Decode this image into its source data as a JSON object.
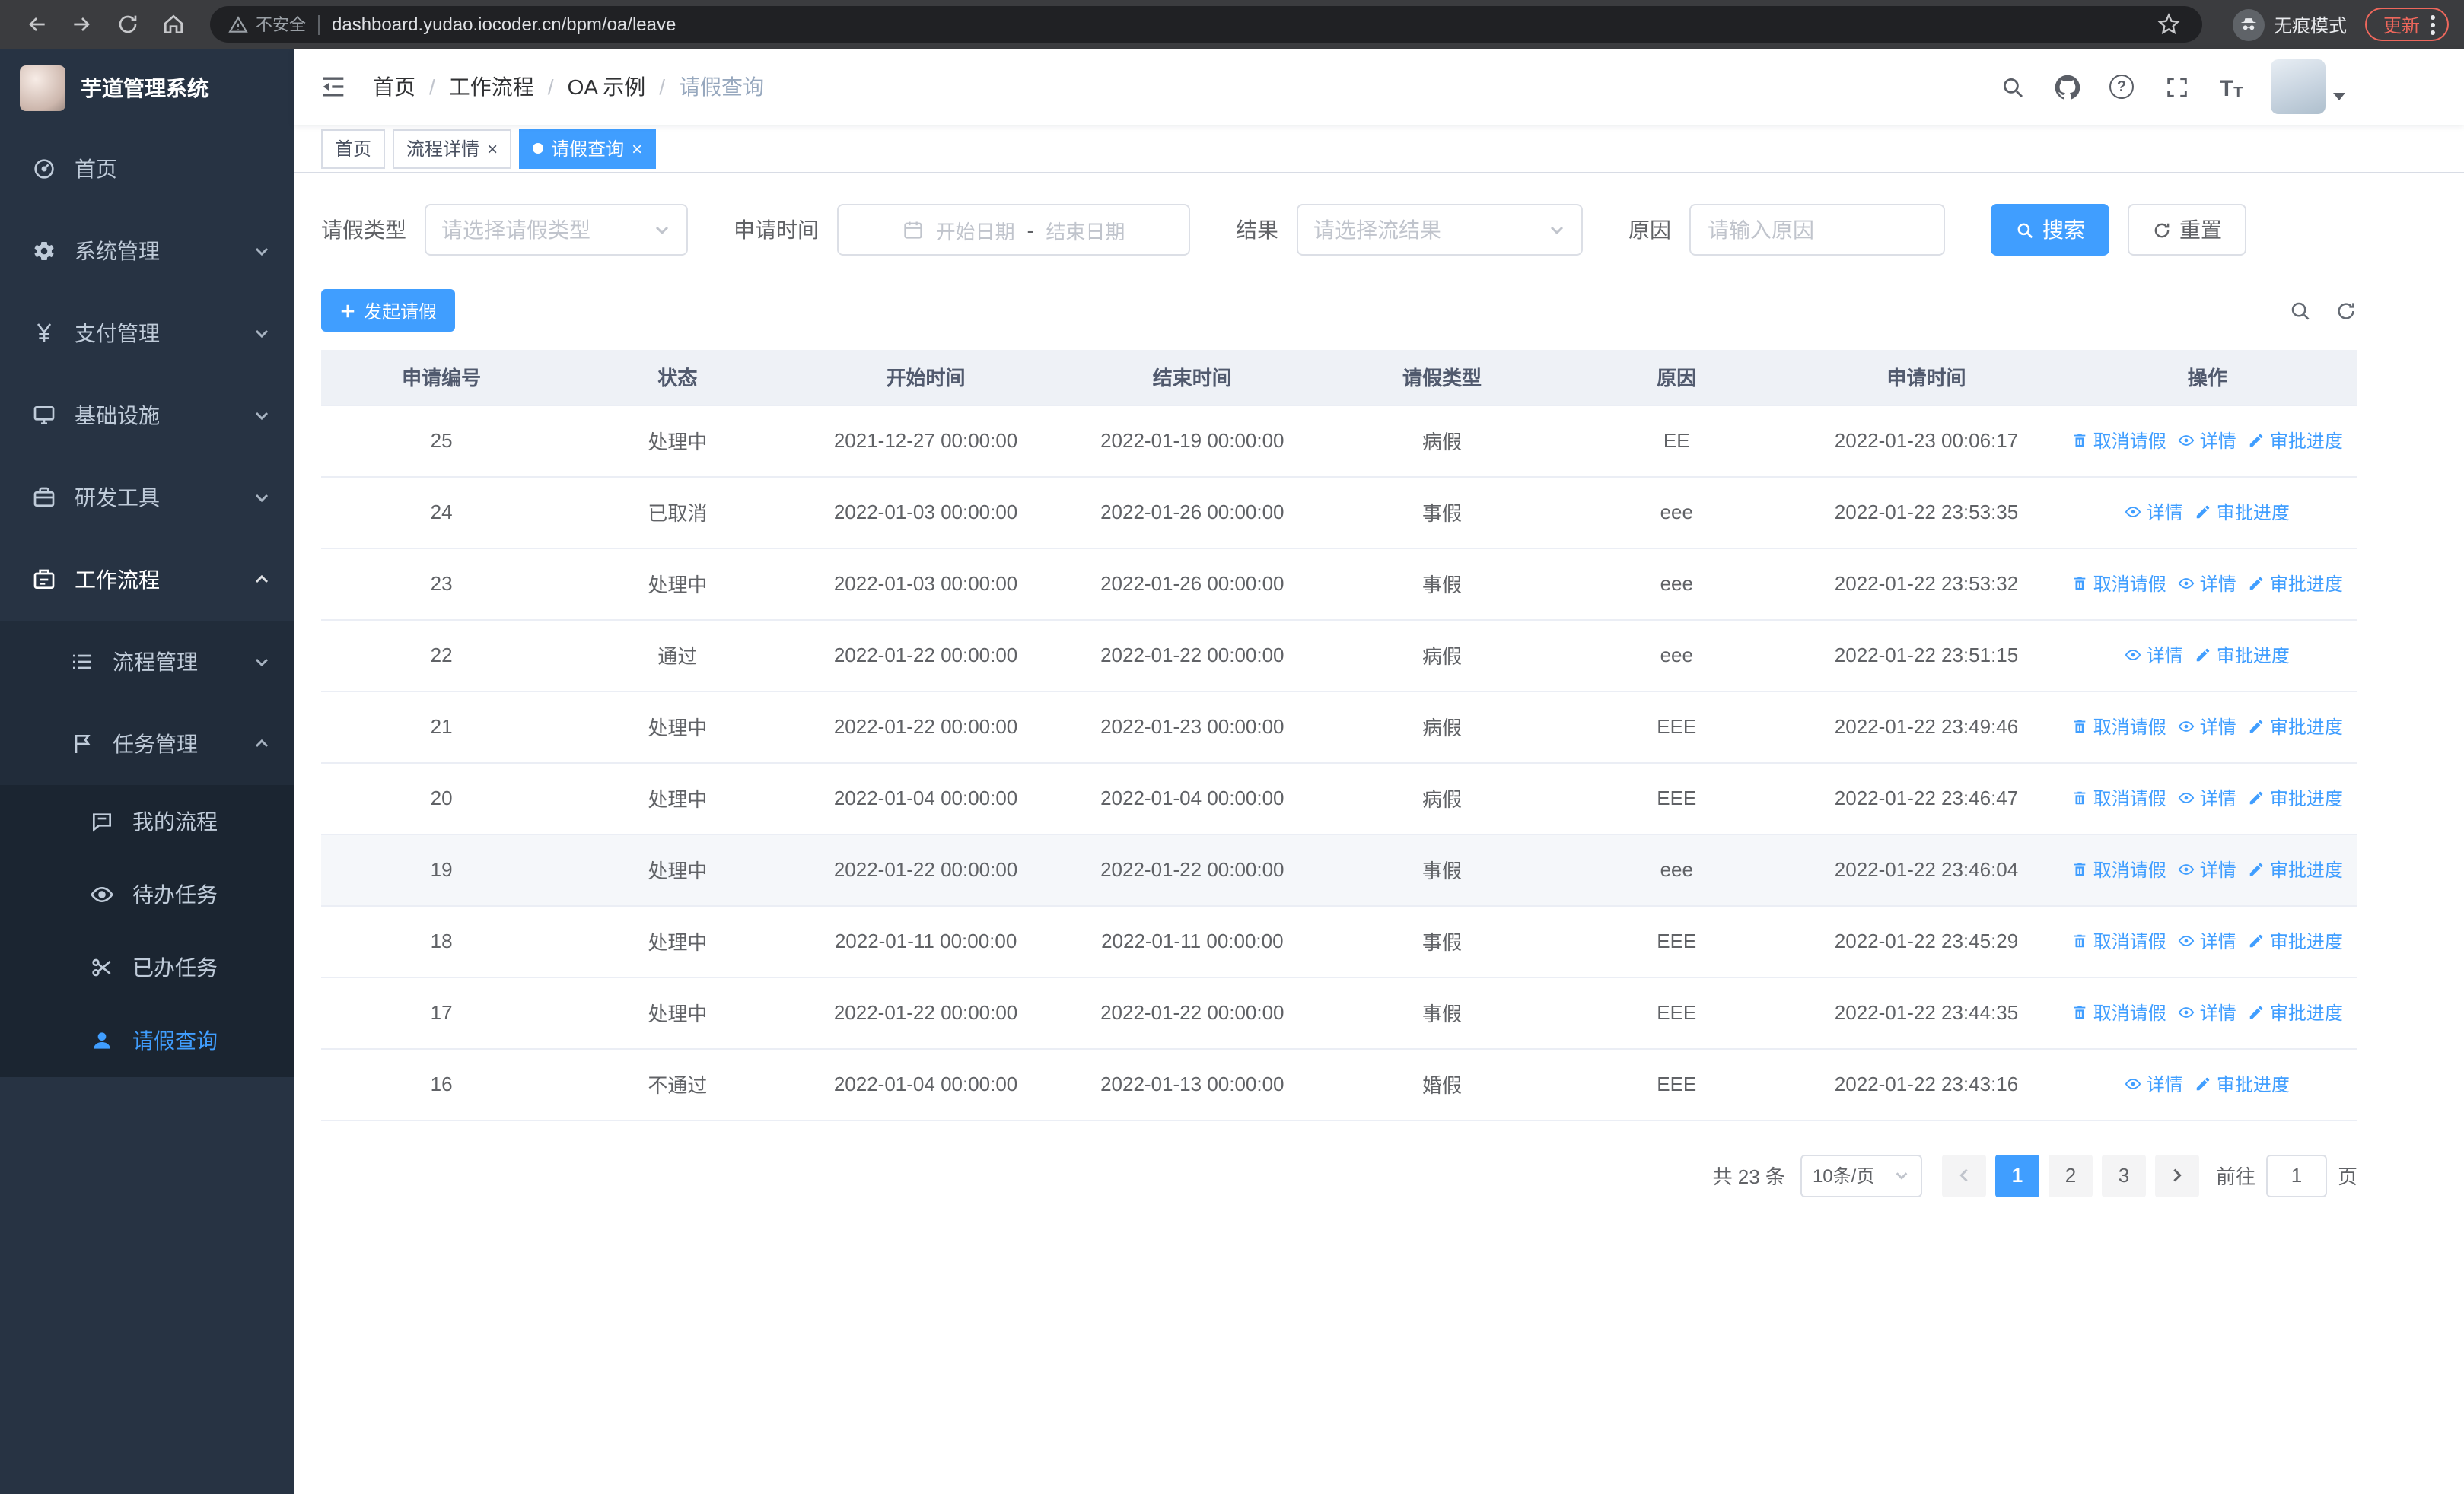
{
  "browser": {
    "security_label": "不安全",
    "url": "dashboard.yudao.iocoder.cn/bpm/oa/leave",
    "incognito_label": "无痕模式",
    "update_label": "更新"
  },
  "sidebar": {
    "logo_title": "芋道管理系统",
    "items": [
      {
        "label": "首页"
      },
      {
        "label": "系统管理"
      },
      {
        "label": "支付管理"
      },
      {
        "label": "基础设施"
      },
      {
        "label": "研发工具"
      },
      {
        "label": "工作流程"
      }
    ],
    "submenu": [
      {
        "label": "流程管理"
      },
      {
        "label": "任务管理"
      }
    ],
    "task_items": [
      {
        "label": "我的流程"
      },
      {
        "label": "待办任务"
      },
      {
        "label": "已办任务"
      },
      {
        "label": "请假查询"
      }
    ]
  },
  "header": {
    "breadcrumb": [
      "首页",
      "工作流程",
      "OA 示例",
      "请假查询"
    ]
  },
  "tabs": [
    {
      "label": "首页",
      "active": false,
      "closable": false
    },
    {
      "label": "流程详情",
      "active": false,
      "closable": true
    },
    {
      "label": "请假查询",
      "active": true,
      "closable": true
    }
  ],
  "filters": {
    "leave_type_label": "请假类型",
    "leave_type_placeholder": "请选择请假类型",
    "apply_time_label": "申请时间",
    "start_date_placeholder": "开始日期",
    "range_separator": "-",
    "end_date_placeholder": "结束日期",
    "result_label": "结果",
    "result_placeholder": "请选择流结果",
    "reason_label": "原因",
    "reason_placeholder": "请输入原因",
    "search_label": "搜索",
    "reset_label": "重置"
  },
  "toolbar": {
    "create_label": "发起请假"
  },
  "table": {
    "columns": [
      "申请编号",
      "状态",
      "开始时间",
      "结束时间",
      "请假类型",
      "原因",
      "申请时间",
      "操作"
    ],
    "actions": {
      "cancel": {
        "label": "取消请假",
        "icon": "delete-icon"
      },
      "detail": {
        "label": "详情",
        "icon": "view-icon"
      },
      "progress": {
        "label": "审批进度",
        "icon": "edit-icon"
      }
    },
    "rows": [
      {
        "id": "25",
        "status": "处理中",
        "start_time": "2021-12-27 00:00:00",
        "end_time": "2022-01-19 00:00:00",
        "leave_type": "病假",
        "reason": "EE",
        "apply_time": "2022-01-23 00:06:17",
        "actions": [
          "cancel",
          "detail",
          "progress"
        ],
        "highlighted": false
      },
      {
        "id": "24",
        "status": "已取消",
        "start_time": "2022-01-03 00:00:00",
        "end_time": "2022-01-26 00:00:00",
        "leave_type": "事假",
        "reason": "eee",
        "apply_time": "2022-01-22 23:53:35",
        "actions": [
          "detail",
          "progress"
        ],
        "highlighted": false
      },
      {
        "id": "23",
        "status": "处理中",
        "start_time": "2022-01-03 00:00:00",
        "end_time": "2022-01-26 00:00:00",
        "leave_type": "事假",
        "reason": "eee",
        "apply_time": "2022-01-22 23:53:32",
        "actions": [
          "cancel",
          "detail",
          "progress"
        ],
        "highlighted": false
      },
      {
        "id": "22",
        "status": "通过",
        "start_time": "2022-01-22 00:00:00",
        "end_time": "2022-01-22 00:00:00",
        "leave_type": "病假",
        "reason": "eee",
        "apply_time": "2022-01-22 23:51:15",
        "actions": [
          "detail",
          "progress"
        ],
        "highlighted": false
      },
      {
        "id": "21",
        "status": "处理中",
        "start_time": "2022-01-22 00:00:00",
        "end_time": "2022-01-23 00:00:00",
        "leave_type": "病假",
        "reason": "EEE",
        "apply_time": "2022-01-22 23:49:46",
        "actions": [
          "cancel",
          "detail",
          "progress"
        ],
        "highlighted": false
      },
      {
        "id": "20",
        "status": "处理中",
        "start_time": "2022-01-04 00:00:00",
        "end_time": "2022-01-04 00:00:00",
        "leave_type": "病假",
        "reason": "EEE",
        "apply_time": "2022-01-22 23:46:47",
        "actions": [
          "cancel",
          "detail",
          "progress"
        ],
        "highlighted": false
      },
      {
        "id": "19",
        "status": "处理中",
        "start_time": "2022-01-22 00:00:00",
        "end_time": "2022-01-22 00:00:00",
        "leave_type": "事假",
        "reason": "eee",
        "apply_time": "2022-01-22 23:46:04",
        "actions": [
          "cancel",
          "detail",
          "progress"
        ],
        "highlighted": true
      },
      {
        "id": "18",
        "status": "处理中",
        "start_time": "2022-01-11 00:00:00",
        "end_time": "2022-01-11 00:00:00",
        "leave_type": "事假",
        "reason": "EEE",
        "apply_time": "2022-01-22 23:45:29",
        "actions": [
          "cancel",
          "detail",
          "progress"
        ],
        "highlighted": false
      },
      {
        "id": "17",
        "status": "处理中",
        "start_time": "2022-01-22 00:00:00",
        "end_time": "2022-01-22 00:00:00",
        "leave_type": "事假",
        "reason": "EEE",
        "apply_time": "2022-01-22 23:44:35",
        "actions": [
          "cancel",
          "detail",
          "progress"
        ],
        "highlighted": false
      },
      {
        "id": "16",
        "status": "不通过",
        "start_time": "2022-01-04 00:00:00",
        "end_time": "2022-01-13 00:00:00",
        "leave_type": "婚假",
        "reason": "EEE",
        "apply_time": "2022-01-22 23:43:16",
        "actions": [
          "detail",
          "progress"
        ],
        "highlighted": false
      }
    ]
  },
  "pagination": {
    "total_label": "共 23 条",
    "page_size_label": "10条/页",
    "pages": [
      "1",
      "2",
      "3"
    ],
    "active_page": "1",
    "goto_label": "前往",
    "goto_value": "1",
    "page_unit_label": "页"
  },
  "colors": {
    "primary": "#409eff",
    "sidebar_bg": "#273343",
    "active_tab_bg": "#409eff",
    "update_badge": "#ee675c"
  }
}
